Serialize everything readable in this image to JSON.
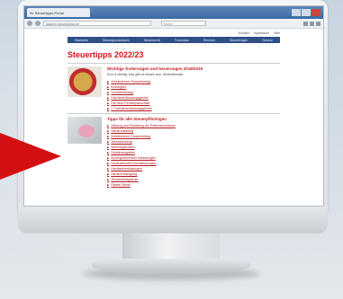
{
  "browser": {
    "tab_title": "Ihr Steuertipps-Portal",
    "address": "www.ihr-steuerportal.de",
    "search_placeholder": "Suche"
  },
  "site": {
    "top_links": [
      "Kontakt",
      "Impressum",
      "Hilfe"
    ],
    "menu": [
      "Startseite",
      "Steuergrundwissen",
      "Steuerrecht",
      "Formulare",
      "Rechner",
      "Steuerfragen",
      "Service"
    ],
    "heading": "Steuertipps 2022/23",
    "section1": {
      "title": "Wichtige Änderungen und Neuerungen 2018/2019",
      "intro": "Kurz & bündig: Das gibt es Neues zum Jahreswechsel.",
      "links": [
        "Arbeitnehmer-Pauschbetrag",
        "Kindergeld",
        "Grundfreibetrag",
        "Familienentlastungsgesetz",
        "Die neue Pendlerpauschale",
        "2. Familienentlastungsgesetz"
      ]
    },
    "section2": {
      "title": "Tipps für alle Steuerpflichtigen",
      "links": [
        "Zahlung und Erstattung der Einkommensteuer",
        "Steuererklärung",
        "Arbeitnehmer-Pauschbetrag",
        "Verlustrücktrag",
        "Werbungskosten",
        "Sonderausgaben",
        "Außergewöhnliche Belastungen",
        "Haushaltsnahe Dienstleistungen",
        "Handwerkerleistungen",
        "Steuerermäßigung",
        "Zinsabschlagsteuer",
        "Riester-Rente"
      ]
    }
  },
  "colors": {
    "accent": "#d4121a",
    "menu": "#2f4f8a",
    "arrow": "#d40f12"
  }
}
